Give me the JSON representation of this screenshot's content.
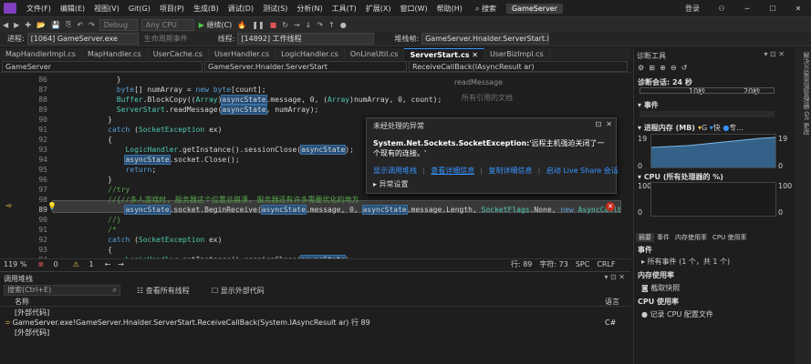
{
  "menu": {
    "items": [
      "文件(F)",
      "编辑(E)",
      "视图(V)",
      "Git(G)",
      "项目(P)",
      "生成(B)",
      "调试(D)",
      "测试(S)",
      "分析(N)",
      "工具(T)",
      "扩展(X)",
      "窗口(W)",
      "帮助(H)"
    ],
    "search": "搜索",
    "solution": "GameServer",
    "login": "登录"
  },
  "toolbar": {
    "config": "Debug",
    "platform": "Any CPU",
    "continue": "继续(C)"
  },
  "process": {
    "proc_label": "进程:",
    "proc_value": "[1064] GameServer.exe",
    "lifecycle": "生命周期事件",
    "thread_label": "线程:",
    "thread_value": "[14892] 工作线程",
    "stack_label": "堆栈帧:",
    "stack_value": "GameServer.Hnalder.ServerStart.Rece"
  },
  "tabs": [
    "MapHandlerImpl.cs",
    "MapHandler.cs",
    "UserCache.cs",
    "UserHandler.cs",
    "LogicHandler.cs",
    "OnLineUtil.cs",
    "ServerStart.cs",
    "UserBizImpl.cs"
  ],
  "nav": {
    "project": "GameServer",
    "class": "GameServer.Hnalder.ServerStart",
    "method": "ReceiveCallBack(IAsyncResult ar)"
  },
  "lines": [
    {
      "n": "86",
      "t": "            }"
    },
    {
      "n": "87",
      "t": "            byte[] numArray = new byte[count];"
    },
    {
      "n": "88",
      "t": "            Buffer.BlockCopy((Array)asyncState.message, 0, (Array)numArray, 0, count);"
    },
    {
      "n": "89",
      "t": "            ServerStart.readMessage(asyncState, numArray);"
    },
    {
      "n": "90",
      "t": "          }"
    },
    {
      "n": "91",
      "t": "          catch (SocketException ex)"
    },
    {
      "n": "92",
      "t": "          {"
    },
    {
      "n": "93",
      "t": "              LogicHandler.getInstance().sessionClose(asyncState);"
    },
    {
      "n": "94",
      "t": "              asyncState.socket.Close();"
    },
    {
      "n": "95",
      "t": "              return;"
    },
    {
      "n": "96",
      "t": "          }"
    },
    {
      "n": "97",
      "t": "          //try"
    },
    {
      "n": "98",
      "t": "          //{//多人游戏时, 服务器这个位置总崩溃, 服务器还有许多需要优化的地方"
    },
    {
      "n": "89",
      "t": "              asyncState.socket.BeginReceive(asyncState.message, 0, asyncState.message.Length, SocketFlags.None, new AsyncCallback"
    },
    {
      "n": "90",
      "t": "          //}"
    },
    {
      "n": "91",
      "t": "          /*"
    },
    {
      "n": "92",
      "t": "          catch (SocketException ex)"
    },
    {
      "n": "93",
      "t": "          {"
    },
    {
      "n": "94",
      "t": "              LogicHandler.getInstance().sessionClose(asyncState);"
    }
  ],
  "peek": {
    "label": "readMessage",
    "refs": "所有引用的文档"
  },
  "exception": {
    "title": "未经处理的异常",
    "type": "System.Net.Sockets.SocketException:",
    "message": "'远程主机强迫关闭了一个现有的连接。'",
    "links": [
      "显示调用堆栈",
      "查看详细信息",
      "复制详细信息",
      "启动 Live Share 会话"
    ],
    "settings": "异常设置"
  },
  "status": {
    "zoom": "119 %",
    "errors": "0",
    "warnings": "1",
    "line": "行: 89",
    "char": "字符: 73",
    "mode": "SPC",
    "eol": "CRLF"
  },
  "callstack": {
    "title": "调用堆栈",
    "search": "搜索(Ctrl+E)",
    "view_threads": "查看所有线程",
    "external": "显示外部代码",
    "col_name": "名称",
    "col_lang": "语言",
    "rows": [
      {
        "name": "[外部代码]",
        "lang": ""
      },
      {
        "name": "GameServer.exe!GameServer.Hnalder.ServerStart.ReceiveCallBack(System.IAsyncResult ar) 行 89",
        "lang": "C#"
      },
      {
        "name": "[外部代码]",
        "lang": ""
      }
    ]
  },
  "diag": {
    "title": "诊断工具",
    "session": "诊断会话: 24 秒",
    "t10": "10秒",
    "t20": "20秒",
    "events": "事件",
    "mem": "进程内存 (MB)",
    "mem_legend": [
      "G",
      "快",
      "专..."
    ],
    "mem_max": "19",
    "mem_min": "0",
    "cpu": "CPU (所有处理器的 %)",
    "cpu_max": "100",
    "cpu_min": "0",
    "tabs": [
      "摘要",
      "事件",
      "内存使用率",
      "CPU 使用率"
    ],
    "events_hdr": "事件",
    "all_events": "所有事件 (1 个，共 1 个)",
    "memuse": "内存使用率",
    "snapshot": "截取快照",
    "cpuuse": "CPU 使用率",
    "cpu_profile": "记录 CPU 配置文件"
  },
  "side": "解决方案资源管理器  Git 更改",
  "colors": {
    "accent": "#3794ff",
    "error": "#e05555",
    "run": "#4ec94e",
    "highlight": "#264f78"
  }
}
